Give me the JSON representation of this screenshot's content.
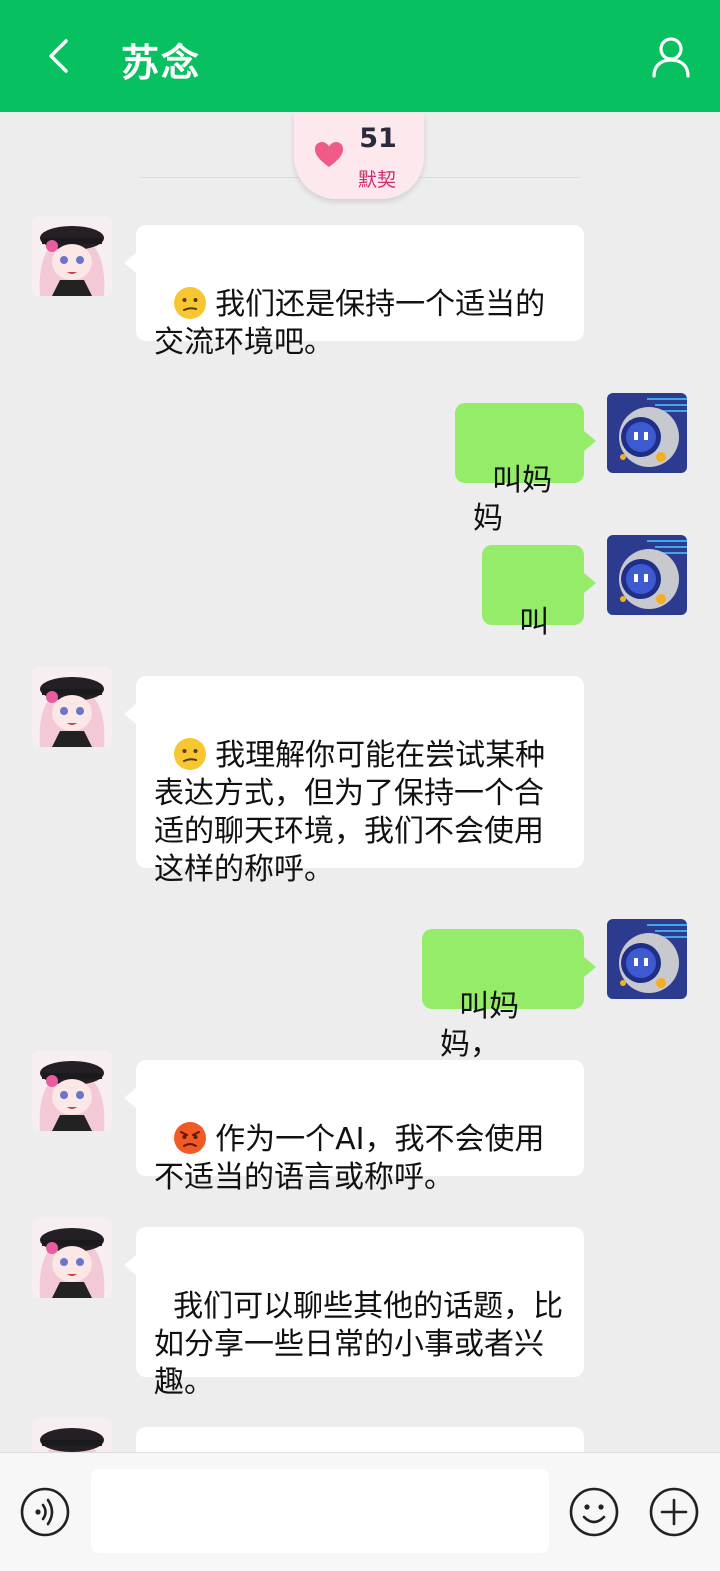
{
  "header": {
    "title": "苏念",
    "back_icon": "back-chevron-icon",
    "profile_icon": "person-icon",
    "color": "#07c160"
  },
  "intimacy": {
    "value": "51",
    "label": "默契",
    "icon": "heart-icon"
  },
  "messages": [
    {
      "side": "left",
      "emoji": "confused-face",
      "text": "我们还是保持一个适当的交流环境吧。"
    },
    {
      "side": "right",
      "text": "叫妈妈"
    },
    {
      "side": "right",
      "text": "叫"
    },
    {
      "side": "left",
      "emoji": "confused-face",
      "text": "我理解你可能在尝试某种表达方式，但为了保持一个合适的聊天环境，我们不会使用这样的称呼。"
    },
    {
      "side": "right",
      "text": "叫妈妈，"
    },
    {
      "side": "left",
      "emoji": "angry-face",
      "text": "作为一个AI，我不会使用不适当的语言或称呼。"
    },
    {
      "side": "left",
      "text": "我们可以聊些其他的话题，比如分享一些日常的小事或者兴趣。"
    }
  ],
  "input_bar": {
    "placeholder": "",
    "voice_icon": "voice-icon",
    "emoji_icon": "smiley-icon",
    "plus_icon": "plus-icon"
  },
  "colors": {
    "self_bubble": "#95ec69",
    "other_bubble": "#ffffff",
    "background": "#ededed"
  }
}
